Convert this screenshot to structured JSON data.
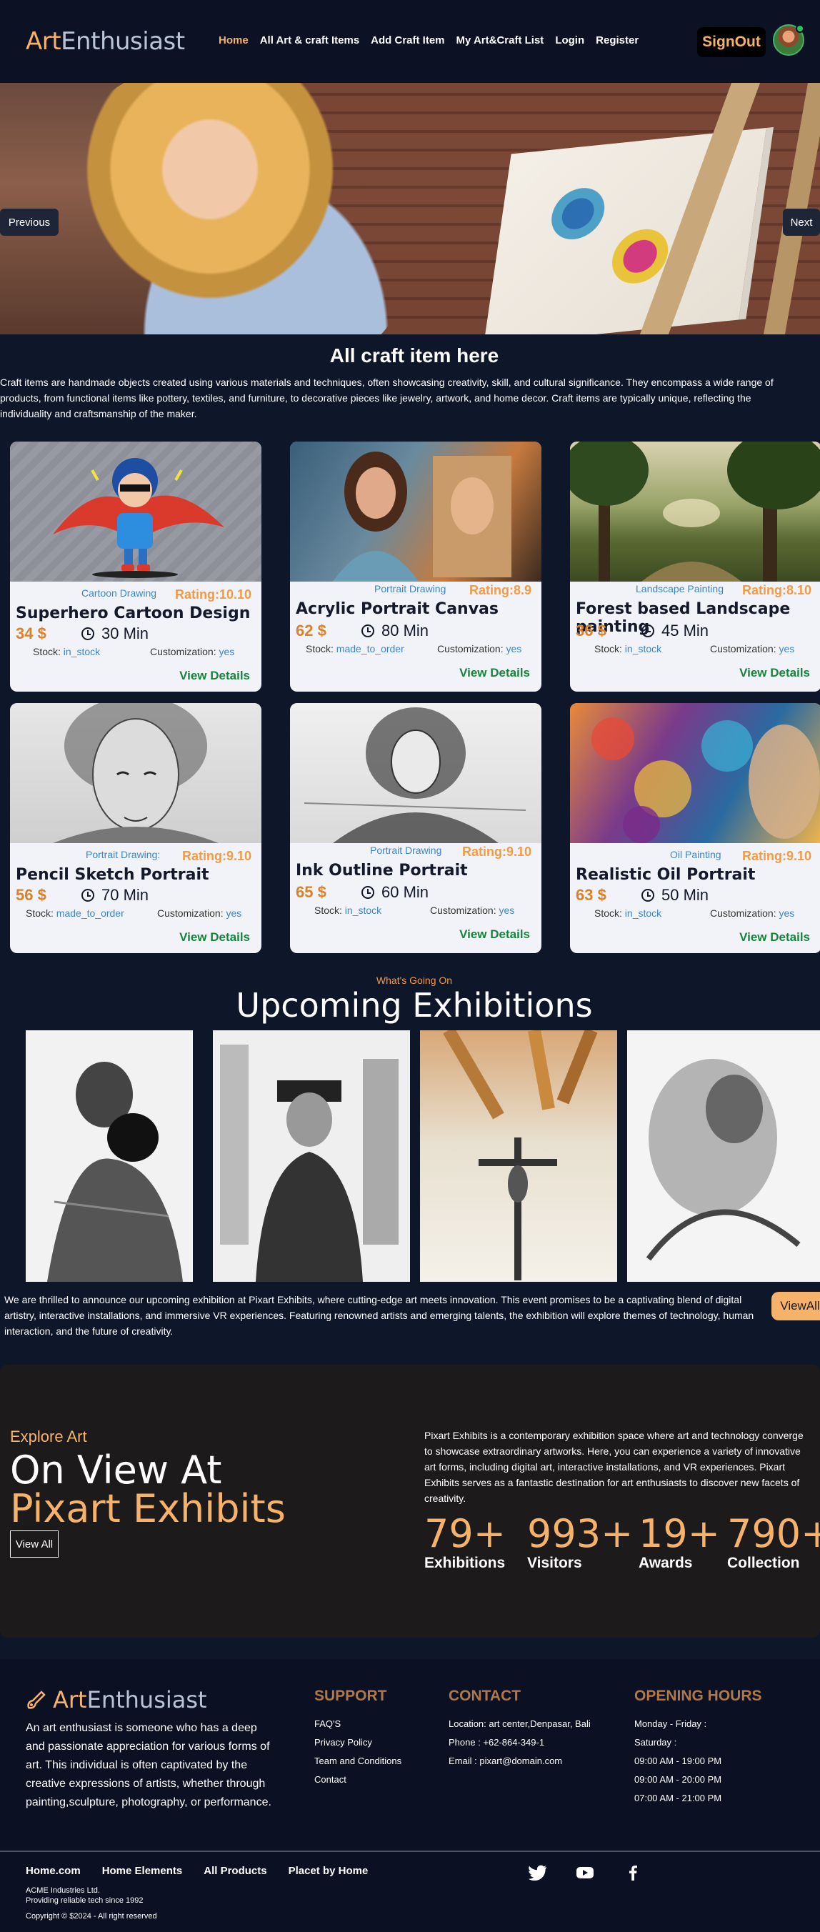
{
  "brand": {
    "art": "Art",
    "enthusiast": "Enthusiast"
  },
  "nav": {
    "links": [
      "Home",
      "All Art & craft Items",
      "Add Craft Item",
      "My Art&Craft List",
      "Login",
      "Register"
    ],
    "signout": "SignOut"
  },
  "hero": {
    "prev": "Previous",
    "next": "Next"
  },
  "craft": {
    "title": "All craft item here",
    "description": "Craft items are handmade objects created using various materials and techniques, often showcasing creativity, skill, and cultural significance. They encompass a wide range of products, from functional items like pottery, textiles, and furniture, to decorative pieces like jewelry, artwork, and home decor. Craft items are typically unique, reflecting the individuality and craftsmanship of the maker.",
    "stock_label": "Stock:",
    "custom_label": "Customization:",
    "details_label": "View Details",
    "items": [
      {
        "category": "Cartoon Drawing",
        "rating": "Rating:10.10",
        "name": "Superhero Cartoon Design",
        "price": "34 $",
        "time": "30 Min",
        "stock": "in_stock",
        "custom": "yes"
      },
      {
        "category": "Portrait Drawing",
        "rating": "Rating:8.9",
        "name": "Acrylic Portrait Canvas",
        "price": "62 $",
        "time": "80 Min",
        "stock": "made_to_order",
        "custom": "yes"
      },
      {
        "category": "Landscape Painting",
        "rating": "Rating:8.10",
        "name": "Forest based Landscape painting",
        "price": "36 $",
        "time": "45 Min",
        "stock": "in_stock",
        "custom": "yes"
      },
      {
        "category": "Portrait Drawing:",
        "rating": "Rating:9.10",
        "name": "Pencil Sketch Portrait",
        "price": "56 $",
        "time": "70 Min",
        "stock": "made_to_order",
        "custom": "yes"
      },
      {
        "category": "Portrait Drawing",
        "rating": "Rating:9.10",
        "name": "Ink Outline Portrait",
        "price": "65 $",
        "time": "60 Min",
        "stock": "in_stock",
        "custom": "yes"
      },
      {
        "category": "Oil Painting",
        "rating": "Rating:9.10",
        "name": "Realistic Oil Portrait",
        "price": "63 $",
        "time": "50 Min",
        "stock": "in_stock",
        "custom": "yes"
      }
    ]
  },
  "exhibitions": {
    "eyebrow": "What's Going On",
    "title": "Upcoming Exhibitions",
    "description": "We are thrilled to announce our upcoming exhibition at Pixart Exhibits, where cutting-edge art meets innovation. This event promises to be a captivating blend of digital artistry, interactive installations, and immersive VR experiences. Featuring renowned artists and emerging talents, the exhibition will explore themes of technology, human interaction, and the future of creativity.",
    "view_all": "ViewAll"
  },
  "pixart": {
    "explore": "Explore Art",
    "on_view": "On View At",
    "title": "Pixart Exhibits",
    "view_all": "View All",
    "description": "Pixart Exhibits is a contemporary exhibition space where art and technology converge to showcase extraordinary artworks. Here, you can experience a variety of innovative art forms, including digital art, interactive installations, and VR experiences. Pixart Exhibits serves as a fantastic destination for art enthusiasts to discover new facets of creativity.",
    "stats": [
      {
        "num": "79+",
        "label": "Exhibitions"
      },
      {
        "num": "993+",
        "label": "Visitors"
      },
      {
        "num": "19+",
        "label": "Awards"
      },
      {
        "num": "790+",
        "label": "Collection"
      }
    ]
  },
  "footer": {
    "about": "An art enthusiast is someone who has a deep and passionate appreciation for various forms of art. This individual is often captivated by the creative expressions of artists, whether through painting,sculpture, photography, or performance.",
    "support": {
      "title": "SUPPORT",
      "items": [
        "FAQ'S",
        "Privacy Policy",
        "Team and Conditions",
        "Contact"
      ]
    },
    "contact": {
      "title": "CONTACT",
      "items": [
        "Location: art center,Denpasar, Bali",
        "Phone : +62-864-349-1",
        "Email : pixart@domain.com"
      ]
    },
    "hours": {
      "title": "OPENING HOURS",
      "items": [
        "Monday - Friday :",
        "Saturday :",
        "09:00 AM - 19:00 PM",
        "09:00 AM - 20:00 PM",
        "07:00 AM - 21:00 PM"
      ]
    },
    "links": [
      "Home.com",
      "Home Elements",
      "All Products",
      "Placet by Home"
    ],
    "company": "ACME Industries Ltd.",
    "tagline": "Providing reliable tech since 1992",
    "copyright": "Copyright © $2024 - All right reserved",
    "social": [
      "twitter-icon",
      "youtube-icon",
      "facebook-icon"
    ]
  },
  "colors": {
    "accent": "#f6b26b",
    "background": "#0e1629",
    "link": "#3f84c8",
    "details": "#16843a"
  }
}
